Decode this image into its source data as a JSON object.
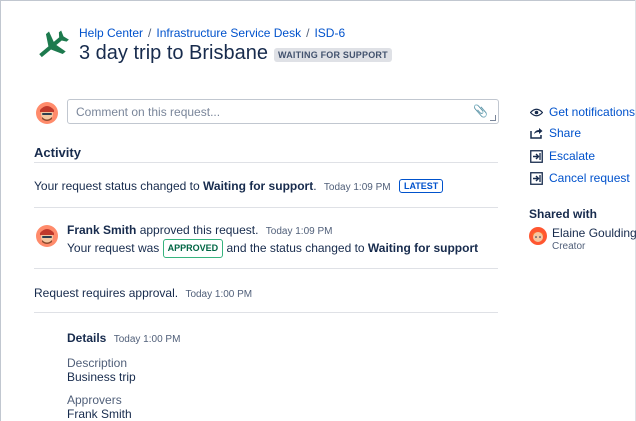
{
  "breadcrumb": {
    "items": [
      "Help Center",
      "Infrastructure Service Desk",
      "ISD-6"
    ],
    "separator": "/"
  },
  "request": {
    "title": "3 day trip to Brisbane",
    "status_badge": "WAITING FOR SUPPORT"
  },
  "comment": {
    "placeholder": "Comment on this request..."
  },
  "activity": {
    "heading": "Activity",
    "events": [
      {
        "text_pre": "Your request status changed to ",
        "text_bold": "Waiting for support",
        "text_post": ".",
        "time": "Today 1:09 PM",
        "badge": "LATEST"
      },
      {
        "author": "Frank Smith",
        "action": " approved this request.",
        "time": "Today 1:09 PM",
        "line2_pre": "Your request was ",
        "badge": "APPROVED",
        "line2_mid": " and the status changed to ",
        "line2_bold": "Waiting for support"
      },
      {
        "text": "Request requires approval.",
        "time": "Today 1:00 PM"
      }
    ],
    "details": {
      "heading": "Details",
      "time": "Today 1:00 PM",
      "fields": [
        {
          "label": "Description",
          "value": "Business trip"
        },
        {
          "label": "Approvers",
          "value": "Frank Smith"
        }
      ]
    }
  },
  "sidebar": {
    "actions": [
      {
        "label": "Get notifications",
        "icon": "eye-icon"
      },
      {
        "label": "Share",
        "icon": "share-icon"
      },
      {
        "label": "Escalate",
        "icon": "escalate-icon"
      },
      {
        "label": "Cancel request",
        "icon": "cancel-request-icon"
      }
    ],
    "shared_with": {
      "heading": "Shared with",
      "people": [
        {
          "name": "Elaine Goulding",
          "role": "Creator"
        }
      ]
    }
  },
  "colors": {
    "link": "#0052CC",
    "text": "#172B4D",
    "approved": "#36B37E",
    "logo": "#1D7A4E"
  }
}
